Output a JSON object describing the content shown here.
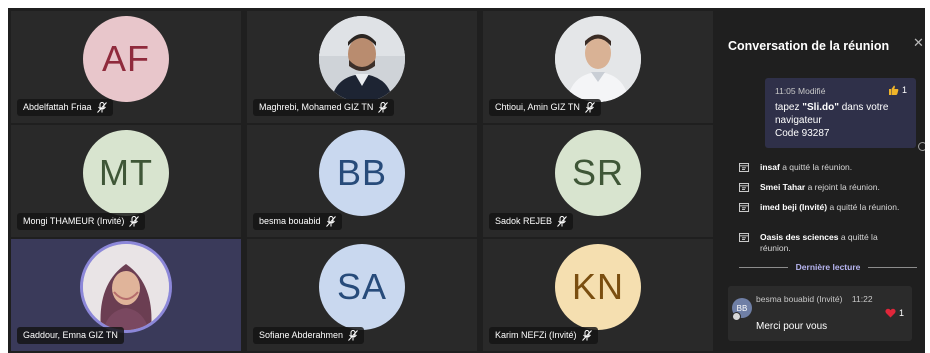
{
  "participants": [
    {
      "name": "Abdelfattah Friaa",
      "initials": "AF",
      "avatar_bg": "#e8c6cb",
      "initials_color": "#8f2a3c"
    },
    {
      "name": "Maghrebi, Mohamed GIZ TN",
      "initials": "",
      "photo": true
    },
    {
      "name": "Chtioui, Amin GIZ TN",
      "initials": "",
      "photo": true
    },
    {
      "name": "Mongi THAMEUR (Invité)",
      "initials": "MT",
      "avatar_bg": "#d8e4cf",
      "initials_color": "#3f5637"
    },
    {
      "name": "besma bouabid",
      "initials": "BB",
      "avatar_bg": "#c9d8ef",
      "initials_color": "#274b7a"
    },
    {
      "name": "Sadok REJEB",
      "initials": "SR",
      "avatar_bg": "#d8e4cf",
      "initials_color": "#3f5637"
    },
    {
      "name": "Gaddour, Emna GIZ TN",
      "initials": "",
      "photo": true,
      "speaking": true
    },
    {
      "name": "Sofiane Abderahmen",
      "initials": "SA",
      "avatar_bg": "#c9d8ef",
      "initials_color": "#274b7a"
    },
    {
      "name": "Karim NEFZi (Invité)",
      "initials": "KN",
      "avatar_bg": "#f5dfb0",
      "initials_color": "#7a4e10"
    }
  ],
  "chat": {
    "title": "Conversation de la réunion",
    "close_icon": "close-icon",
    "pinned_message": {
      "time": "11:05",
      "edited": "Modifié",
      "body_prefix": "tapez ",
      "body_highlight": "\"Sli.do\"",
      "body_suffix": " dans votre navigateur",
      "code": "Code 93287",
      "reaction_count": "1"
    },
    "events": [
      {
        "who": "insaf",
        "text": " a quitté la réunion."
      },
      {
        "who": "Smei Tahar",
        "text": " a rejoint la réunion."
      },
      {
        "who": "imed beji (Invité)",
        "text": " a quitté la réunion."
      },
      {
        "who": "Oasis des sciences",
        "text": " a quitté la réunion."
      }
    ],
    "last_read": "Dernière lecture",
    "reply": {
      "initials": "BB",
      "author": "besma bouabid (Invité)",
      "time": "11:22",
      "body": "Merci pour vous",
      "reaction_count": "1"
    }
  },
  "colors": {
    "background": "#1f1f1f",
    "tile": "#292929",
    "accent": "#8c87d9"
  }
}
